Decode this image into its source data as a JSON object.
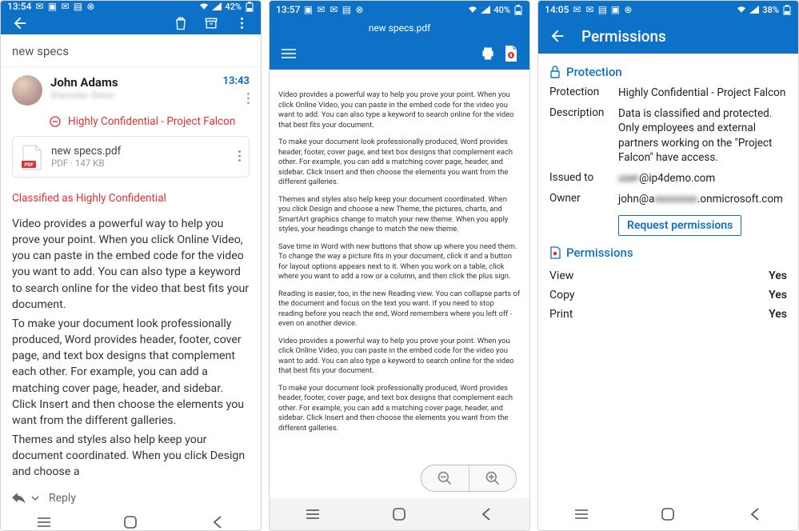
{
  "screens": {
    "email": {
      "status": {
        "time": "13:54",
        "battery": "42%"
      },
      "subject": "new specs",
      "sender": {
        "name": "John Adams",
        "sub": "Stanislav Belov",
        "time": "13:43"
      },
      "classification": "Highly Confidential - Project Falcon",
      "attachment": {
        "name": "new specs.pdf",
        "meta": "PDF · 147 KB"
      },
      "class_note": "Classified as Highly Confidential",
      "body_p1": "Video provides a powerful way to help you prove your point. When you click Online Video, you can paste in the embed code for the video you want to add. You can also type a keyword to search online for the video that best fits your document.",
      "body_p2": "To make your document look professionally produced, Word provides header, footer, cover page, and text box designs that complement each other. For example, you can add a matching cover page, header, and sidebar. Click Insert and then choose the elements you want from the different galleries.",
      "body_p3": "Themes and styles also help keep your document coordinated. When you click Design and choose a",
      "reply": "Reply"
    },
    "pdf": {
      "status": {
        "time": "13:57",
        "battery": "40%"
      },
      "title": "new specs.pdf",
      "paras": [
        "Video provides a powerful way to help you prove your point. When you click Online Video, you can paste in the embed code for the video you want to add. You can also type a keyword to search online for the video that best fits your document.",
        "To make your document look professionally produced, Word provides header, footer, cover page, and text box designs that complement each other. For example, you can add a matching cover page, header, and sidebar. Click Insert and then choose the elements you want from the different galleries.",
        "Themes and styles also help keep your document coordinated. When you click Design and choose a new Theme, the pictures, charts, and SmartArt graphics change to match your new theme. When you apply styles, your headings change to match the new theme.",
        "Save time in Word with new buttons that show up where you need them. To change the way a picture fits in your document, click it and a button for layout options appears next to it. When you work on a table, click where you want to add a row or a column, and then click the plus sign.",
        "Reading is easier, too, in the new Reading view. You can collapse parts of the document and focus on the text you want. If you need to stop reading before you reach the end, Word remembers where you left off - even on another device.",
        "Video provides a powerful way to help you prove your point. When you click Online Video, you can paste in the embed code for the video you want to add. You can also type a keyword to search online for the video that best fits your document.",
        "To make your document look professionally produced, Word provides header, footer, cover page, and text box designs that complement each other. For example, you can add a matching cover page, header, and sidebar. Click Insert and then choose the elements you want from the different galleries."
      ]
    },
    "perm": {
      "status": {
        "time": "14:05",
        "battery": "38%"
      },
      "title": "Permissions",
      "protection_head": "Protection",
      "fields": {
        "protection_k": "Protection",
        "protection_v": "Highly Confidential - Project Falcon",
        "description_k": "Description",
        "description_v": "Data is classified and protected. Only employees and external partners working on the \"Project Falcon\" have access.",
        "issued_k": "Issued to",
        "issued_blur": "user",
        "issued_suffix": "@ip4demo.com",
        "owner_k": "Owner",
        "owner_prefix": "john@a",
        "owner_blur": "xxxxxxxx",
        "owner_suffix": ".onmicrosoft.com"
      },
      "request_btn": "Request permissions",
      "permissions_head": "Permissions",
      "rights": [
        {
          "name": "View",
          "value": "Yes"
        },
        {
          "name": "Copy",
          "value": "Yes"
        },
        {
          "name": "Print",
          "value": "Yes"
        }
      ]
    }
  },
  "icons": {
    "mail": "✉",
    "signal": "▮",
    "wifi": "⌵"
  }
}
